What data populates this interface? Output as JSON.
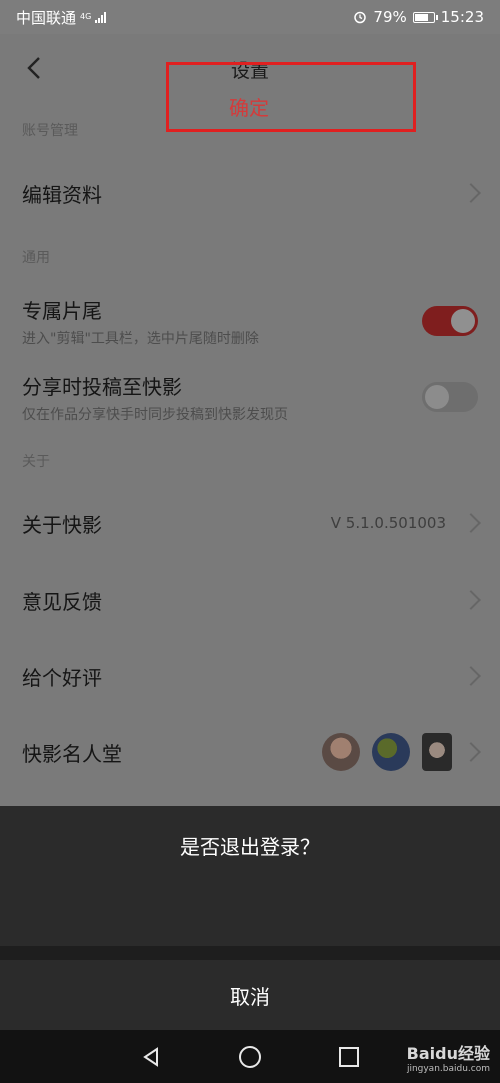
{
  "statusbar": {
    "carrier": "中国联通",
    "network": "4G",
    "battery": "79%",
    "battery_level": 0.79,
    "time": "15:23"
  },
  "header": {
    "title": "设置"
  },
  "sections": {
    "account": "账号管理",
    "general": "通用",
    "about": "关于"
  },
  "rows": {
    "edit_profile": "编辑资料",
    "exclusive_ending": {
      "label": "专属片尾",
      "sub": "进入\"剪辑\"工具栏，选中片尾随时删除",
      "enabled": true
    },
    "share_post": {
      "label": "分享时投稿至快影",
      "sub": "仅在作品分享快手时同步投稿到快影发现页",
      "enabled": false
    },
    "about_app": {
      "label": "关于快影",
      "version": "V 5.1.0.501003"
    },
    "feedback": "意见反馈",
    "rate": "给个好评",
    "hall_of_fame": "快影名人堂"
  },
  "dialog": {
    "title": "是否退出登录？",
    "confirm": "确定",
    "cancel": "取消"
  },
  "watermark": {
    "brand": "Baidu经验",
    "url": "jingyan.baidu.com"
  },
  "colors": {
    "confirm_text": "#d43b3b",
    "highlight_border": "#e02020",
    "toggle_on": "#7f1e1e"
  }
}
